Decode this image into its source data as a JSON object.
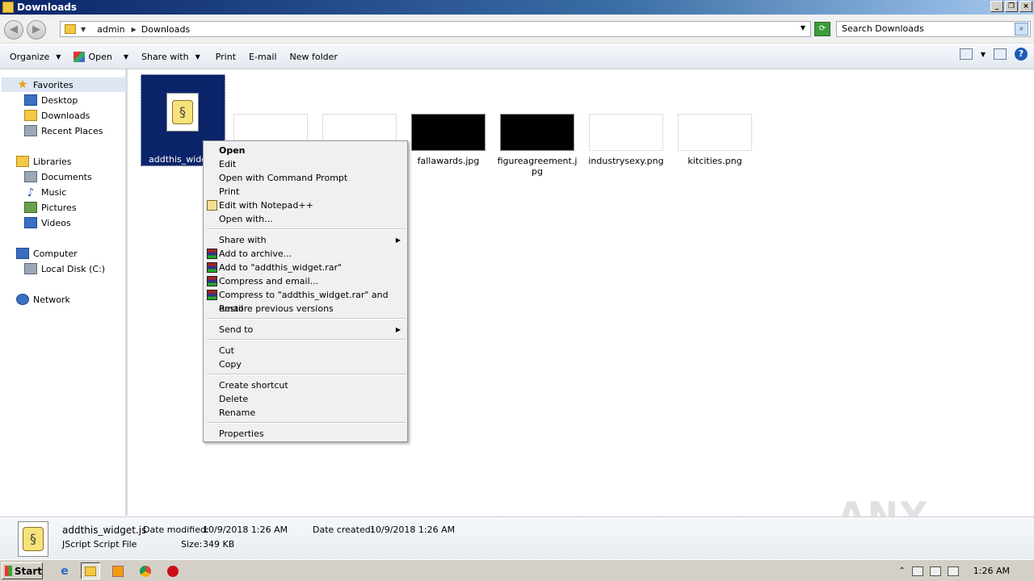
{
  "window": {
    "title": "Downloads"
  },
  "address": {
    "crumbs": [
      "admin",
      "Downloads"
    ],
    "search_placeholder": "Search Downloads"
  },
  "toolbar": {
    "organize": "Organize",
    "open": "Open",
    "share_with": "Share with",
    "print": "Print",
    "email": "E-mail",
    "new_folder": "New folder"
  },
  "nav": {
    "favorites": "Favorites",
    "desktop": "Desktop",
    "downloads": "Downloads",
    "recent_places": "Recent Places",
    "libraries": "Libraries",
    "documents": "Documents",
    "music": "Music",
    "pictures": "Pictures",
    "videos": "Videos",
    "computer": "Computer",
    "local_disk": "Local Disk (C:)",
    "network": "Network"
  },
  "files": {
    "selected": "addthis_widge",
    "items": [
      {
        "name": "",
        "dark": false
      },
      {
        "name": "",
        "dark": false
      },
      {
        "name": "fallawards.jpg",
        "dark": true
      },
      {
        "name": "figureagreement.jpg",
        "dark": true
      },
      {
        "name": "industrysexy.png",
        "dark": false
      },
      {
        "name": "kitcities.png",
        "dark": false
      }
    ]
  },
  "context_menu": {
    "open": "Open",
    "edit": "Edit",
    "open_cmd": "Open with Command Prompt",
    "print": "Print",
    "edit_npp": "Edit with Notepad++",
    "open_with": "Open with...",
    "share_with": "Share with",
    "add_archive": "Add to archive...",
    "add_rar": "Add to \"addthis_widget.rar\"",
    "compress_email": "Compress and email...",
    "compress_rar_email": "Compress to \"addthis_widget.rar\" and email",
    "restore": "Restore previous versions",
    "send_to": "Send to",
    "cut": "Cut",
    "copy": "Copy",
    "create_shortcut": "Create shortcut",
    "delete": "Delete",
    "rename": "Rename",
    "properties": "Properties"
  },
  "details": {
    "filename": "addthis_widget.js",
    "type": "JScript Script File",
    "modified_label": "Date modified:",
    "modified": "10/9/2018 1:26 AM",
    "created_label": "Date created:",
    "created": "10/9/2018 1:26 AM",
    "size_label": "Size:",
    "size": "349 KB"
  },
  "watermark": "ANY RUN",
  "taskbar": {
    "start": "Start",
    "clock": "1:26 AM"
  }
}
